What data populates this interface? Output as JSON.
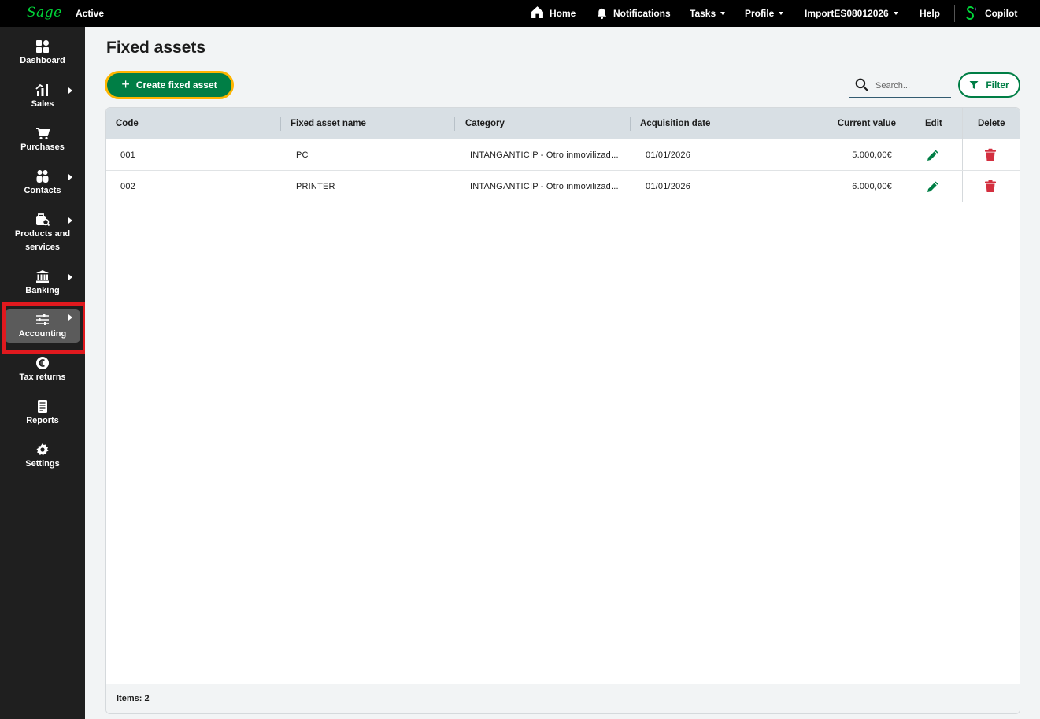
{
  "topbar": {
    "logo": "Sage",
    "status": "Active",
    "nav": {
      "home": "Home",
      "notifications": "Notifications",
      "tasks": "Tasks",
      "profile": "Profile",
      "company": "ImportES08012026",
      "help": "Help",
      "copilot": "Copilot"
    }
  },
  "sidebar": {
    "items": [
      {
        "label": "Dashboard",
        "icon": "dashboard-icon"
      },
      {
        "label": "Sales",
        "icon": "sales-chart-icon"
      },
      {
        "label": "Purchases",
        "icon": "cart-icon"
      },
      {
        "label": "Contacts",
        "icon": "contacts-icon"
      },
      {
        "label": "Products and services",
        "icon": "products-icon"
      },
      {
        "label": "Banking",
        "icon": "bank-icon"
      },
      {
        "label": "Accounting",
        "icon": "sliders-icon"
      },
      {
        "label": "Tax returns",
        "icon": "euro-icon"
      },
      {
        "label": "Reports",
        "icon": "report-icon"
      },
      {
        "label": "Settings",
        "icon": "gear-icon"
      }
    ],
    "active": "Accounting"
  },
  "main": {
    "title": "Fixed assets",
    "create_button": "Create fixed asset",
    "search_placeholder": "Search...",
    "filter_button": "Filter",
    "table": {
      "columns": [
        "Code",
        "Fixed asset name",
        "Category",
        "Acquisition date",
        "Current value",
        "Edit",
        "Delete"
      ],
      "rows": [
        {
          "code": "001",
          "name": "PC",
          "category": "INTANGANTICIP - Otro inmovilizad...",
          "date": "01/01/2026",
          "value": "5.000,00€"
        },
        {
          "code": "002",
          "name": "PRINTER",
          "category": "INTANGANTICIP - Otro inmovilizad...",
          "date": "01/01/2026",
          "value": "6.000,00€"
        }
      ],
      "footer": "Items: 2"
    }
  },
  "colors": {
    "brand_green": "#007e45",
    "focus_yellow": "#ffb500",
    "delete_red": "#d32f3f",
    "sidebar_bg": "#1f1f1f",
    "highlight_red": "#e0191e"
  }
}
